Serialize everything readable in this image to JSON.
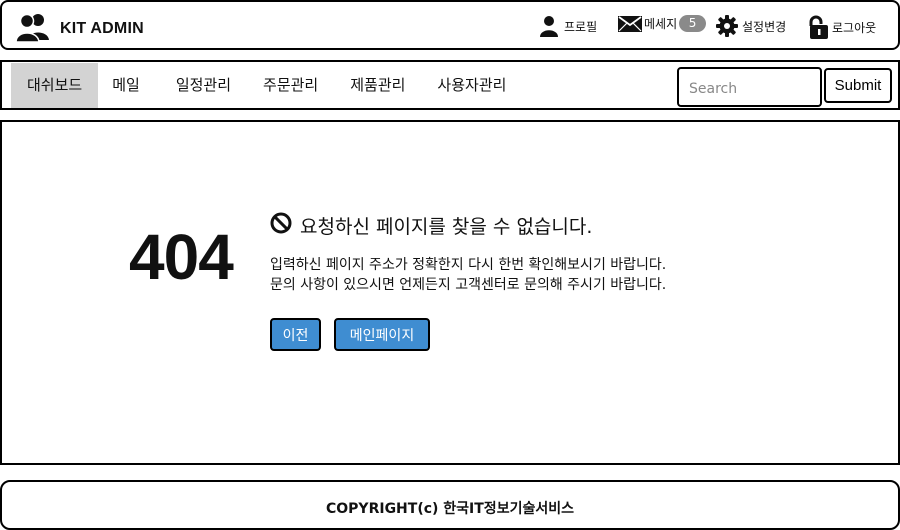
{
  "header": {
    "brand": "KIT ADMIN",
    "nav": {
      "profile": "프로필",
      "messages": "메세지",
      "messages_count": "5",
      "settings": "설정변경",
      "logout": "로그아웃"
    }
  },
  "menubar": {
    "items": [
      "대쉬보드",
      "메일",
      "일정관리",
      "주문관리",
      "제품관리",
      "사용자관리"
    ],
    "active_index": 0,
    "search_placeholder": "Search",
    "submit_label": "Submit"
  },
  "error": {
    "code": "404",
    "title": "요청하신 페이지를 찾을 수 없습니다.",
    "line1": "입력하신 페이지 주소가 정확한지 다시 한번 확인해보시기 바랍니다.",
    "line2": "문의 사항이 있으시면 언제든지 고객센터로 문의해 주시기 바랍니다.",
    "back_label": "이전",
    "home_label": "메인페이지"
  },
  "footer": {
    "copyright": "COPYRIGHT(c) 한국IT정보기술서비스"
  },
  "colors": {
    "button_blue": "#3f8dd1",
    "active_menu_bg": "#d3d3d3",
    "badge_gray": "#8a8a8a"
  },
  "icons": [
    "users-icon",
    "user-icon",
    "envelope-icon",
    "gear-icon",
    "unlock-icon",
    "ban-icon"
  ]
}
